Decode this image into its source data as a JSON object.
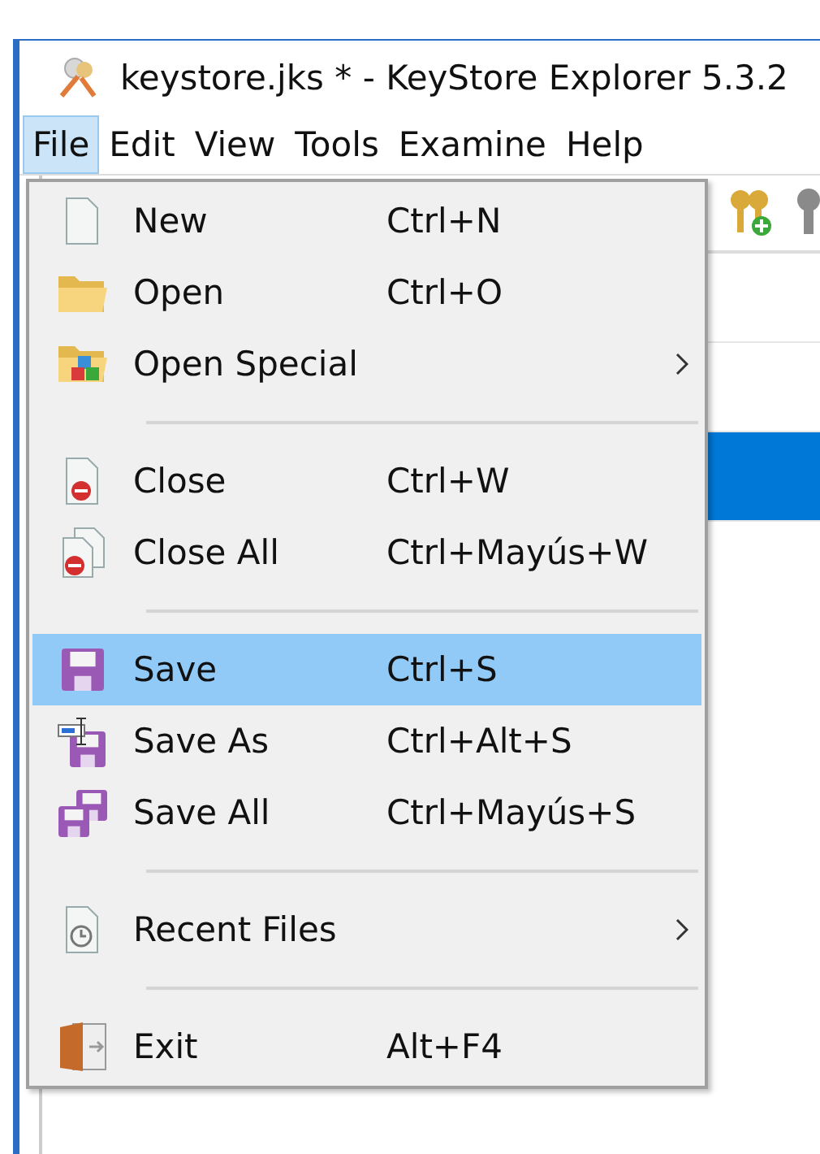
{
  "window": {
    "title": "keystore.jks * - KeyStore Explorer 5.3.2"
  },
  "menu_bar": [
    {
      "label": "File",
      "selected": true
    },
    {
      "label": "Edit",
      "selected": false
    },
    {
      "label": "View",
      "selected": false
    },
    {
      "label": "Tools",
      "selected": false
    },
    {
      "label": "Examine",
      "selected": false
    },
    {
      "label": "Help",
      "selected": false
    }
  ],
  "table": {
    "rows": [
      {
        "selected": false
      },
      {
        "selected": false
      },
      {
        "selected": true
      }
    ]
  },
  "file_menu": [
    {
      "kind": "item",
      "label": "New",
      "shortcut": "Ctrl+N",
      "submenu": false,
      "selected": false
    },
    {
      "kind": "item",
      "label": "Open",
      "shortcut": "Ctrl+O",
      "submenu": false,
      "selected": false
    },
    {
      "kind": "item",
      "label": "Open Special",
      "submenu": true,
      "selected": false
    },
    {
      "kind": "separator"
    },
    {
      "kind": "item",
      "label": "Close",
      "shortcut": "Ctrl+W",
      "submenu": false,
      "selected": false
    },
    {
      "kind": "item",
      "label": "Close All",
      "shortcut": "Ctrl+Mayús+W",
      "submenu": false,
      "selected": false
    },
    {
      "kind": "separator"
    },
    {
      "kind": "item",
      "label": "Save",
      "shortcut": "Ctrl+S",
      "submenu": false,
      "selected": true
    },
    {
      "kind": "item",
      "label": "Save As",
      "shortcut": "Ctrl+Alt+S",
      "submenu": false,
      "selected": false
    },
    {
      "kind": "item",
      "label": "Save All",
      "shortcut": "Ctrl+Mayús+S",
      "submenu": false,
      "selected": false
    },
    {
      "kind": "separator"
    },
    {
      "kind": "item",
      "label": "Recent Files",
      "submenu": true,
      "selected": false
    },
    {
      "kind": "separator"
    },
    {
      "kind": "item",
      "label": "Exit",
      "shortcut": "Alt+F4",
      "submenu": false,
      "selected": false
    }
  ]
}
